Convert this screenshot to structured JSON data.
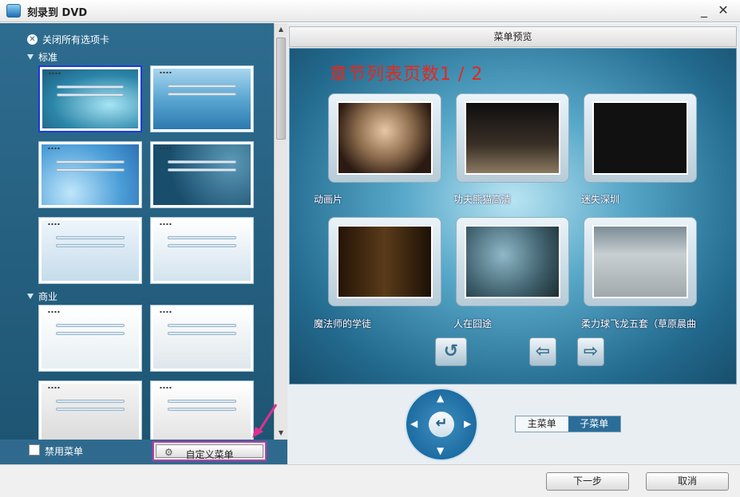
{
  "window": {
    "title": "刻录到 DVD",
    "minimize_glyph": "_",
    "close_glyph": "✕"
  },
  "sidebar": {
    "close_all_tabs": "关闭所有选项卡",
    "category_standard": "标准",
    "category_business": "商业",
    "disable_menu_label": "禁用菜单",
    "custom_menu_button": "自定义菜单"
  },
  "preview": {
    "header": "菜单预览",
    "page_title": "章节列表页数1 / 2",
    "chapters": [
      {
        "label": "动画片",
        "icon": "video-thumbnail"
      },
      {
        "label": "功夫熊猫高清",
        "icon": "video-thumbnail"
      },
      {
        "label": "迷失深圳",
        "icon": "video-thumbnail"
      },
      {
        "label": "魔法师的学徒",
        "icon": "video-thumbnail"
      },
      {
        "label": "人在囧途",
        "icon": "video-thumbnail"
      },
      {
        "label": "柔力球飞龙五套（草原晨曲",
        "icon": "video-thumbnail"
      }
    ],
    "main_menu_tab": "主菜单",
    "sub_menu_tab": "子菜单"
  },
  "footer": {
    "next_button": "下一步",
    "cancel_button": "取消"
  },
  "colors": {
    "accent": "#2b6d99",
    "highlight": "#c23aa5",
    "title_red": "#e8261c"
  }
}
